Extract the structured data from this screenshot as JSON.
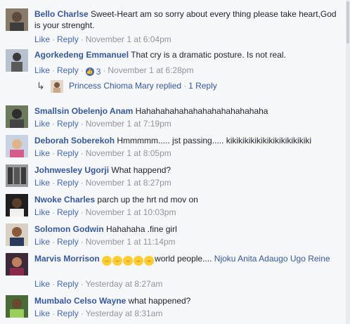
{
  "actions": {
    "like": "Like",
    "reply": "Reply",
    "sep": "·"
  },
  "comments": [
    {
      "author": "Bello Charlse",
      "text": "Sweet-Heart am so sorry about every thing please take heart,God is your strenght.",
      "time": "November 1 at 6:04pm"
    },
    {
      "author": "Agorkedeng Emmanuel",
      "text": "That cry is a dramatic posture. Is not real.",
      "time": "November 1 at 6:28pm",
      "like_count": "3"
    },
    {
      "author": "Smallsin Obelenjo Anam",
      "text": "Hahahahahahahahahahahahahaha",
      "time": "November 1 at 7:19pm"
    },
    {
      "author": "Deborah Soberekoh",
      "text": "Hmmmmm..... jst passing..... kikikikikikikikikikikikikiki",
      "time": "November 1 at 8:05pm"
    },
    {
      "author": "Johnwesley Ugorji",
      "text": "What happend?",
      "time": "November 1 at 8:27pm"
    },
    {
      "author": "Nwoke Charles",
      "text": "parch up the hrt nd mov on",
      "time": "November 1 at 10:03pm"
    },
    {
      "author": "Solomon Godwin",
      "text": "Hahahaha .fine girl",
      "time": "November 1 at 11:14pm"
    },
    {
      "author": "Marvis Morrison",
      "text": "world people....",
      "tag": "Njoku Anita Adaugo Ugo Reine",
      "emoji_count": 5,
      "time": "Yesterday at 8:27am"
    },
    {
      "author": "Mumbalo Celso Wayne",
      "text": "what happened?",
      "time": "Yesterday at 8:31am"
    }
  ],
  "reply_preview": {
    "author": "Princess Chioma Mary",
    "verb": "replied",
    "count": "1 Reply"
  },
  "colors": {
    "link": "#365899",
    "action": "#4267b2",
    "meta": "#90949c",
    "bg": "#f6f7f9"
  }
}
